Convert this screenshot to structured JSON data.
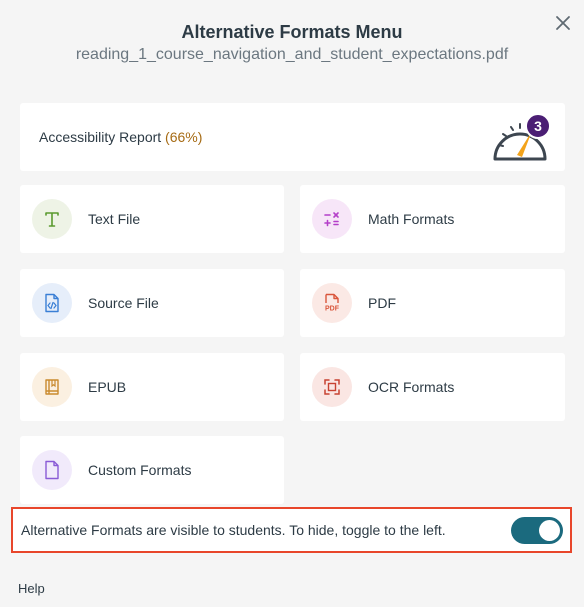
{
  "header": {
    "title": "Alternative Formats Menu",
    "filename": "reading_1_course_navigation_and_student_expectations.pdf"
  },
  "report": {
    "label": "Accessibility Report",
    "percent": "(66%)",
    "badge": "3",
    "score_fraction": 0.66
  },
  "formats": [
    {
      "label": "Text File",
      "icon": "text-file-icon",
      "color": "#5a9a2f"
    },
    {
      "label": "Math Formats",
      "icon": "math-formats-icon",
      "color": "#b43fc9"
    },
    {
      "label": "Source File",
      "icon": "source-file-icon",
      "color": "#3a7fd5"
    },
    {
      "label": "PDF",
      "icon": "pdf-icon",
      "color": "#d9553b"
    },
    {
      "label": "EPUB",
      "icon": "epub-icon",
      "color": "#c98a2e"
    },
    {
      "label": "OCR Formats",
      "icon": "ocr-formats-icon",
      "color": "#c84232"
    },
    {
      "label": "Custom Formats",
      "icon": "custom-formats-icon",
      "color": "#8a5bd6"
    }
  ],
  "visibility": {
    "text": "Alternative Formats are visible to students. To hide, toggle to the left.",
    "enabled": true
  },
  "footer": {
    "help": "Help"
  },
  "colors": {
    "accent": "#1b6a7e",
    "highlight_border": "#e8462b",
    "percent": "#a66b14"
  }
}
